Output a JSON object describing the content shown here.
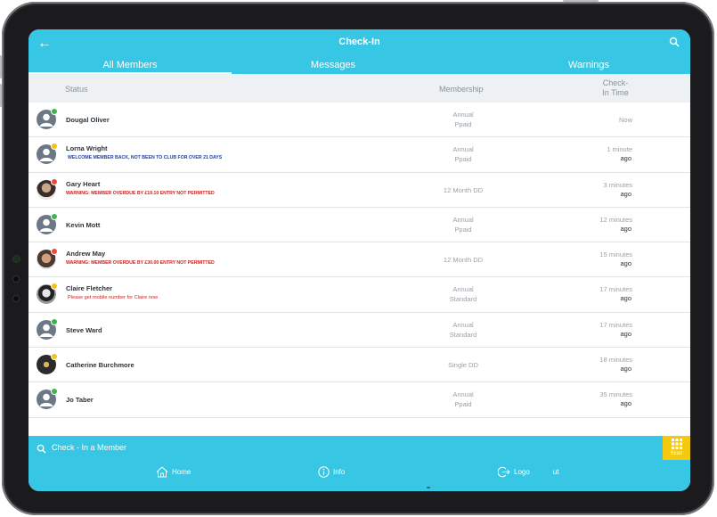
{
  "header": {
    "title": "Check-In",
    "back_icon": "arrow-left-icon",
    "search_icon": "search-icon"
  },
  "tabs": [
    {
      "label": "All Members",
      "active": true
    },
    {
      "label": "Messages",
      "active": false
    },
    {
      "label": "Warnings",
      "active": false
    }
  ],
  "columns": {
    "status": "Status",
    "membership": "Membership",
    "checkin_line1": "Check-",
    "checkin_line2": "In Time"
  },
  "colors": {
    "accent": "#37c6e3",
    "scan": "#f5c90f",
    "online": "#3fb34f",
    "pending": "#f2c316",
    "alert": "#e84a3c",
    "warning_text": "#cc2222",
    "info_text": "#1f3fa8"
  },
  "members": [
    {
      "name": "Dougal Oliver",
      "note": "",
      "note_type": "",
      "membership_1": "Annual",
      "membership_2": "Ppaid",
      "time_1": "Now",
      "time_2": "",
      "status": "online",
      "avatar": "default"
    },
    {
      "name": "Lorna Wright",
      "note": "WELCOME MEMBER BACK, NOT BEEN TO CLUB FOR OVER 21 DAYS",
      "note_type": "info",
      "membership_1": "Annual",
      "membership_2": "Ppaid",
      "time_1": "1 minute",
      "time_2": "ago",
      "status": "pending",
      "avatar": "default"
    },
    {
      "name": "Gary Heart",
      "note": "WARNING: MEMBER OVERDUE BY £19.10 ENTRY NOT PERMITTED",
      "note_type": "warning",
      "membership_1": "12 Month DD",
      "membership_2": "",
      "time_1": "3 minutes",
      "time_2": "ago",
      "status": "alert",
      "avatar": "photo"
    },
    {
      "name": "Kevin Mott",
      "note": "",
      "note_type": "",
      "membership_1": "Annual",
      "membership_2": "Ppaid",
      "time_1": "12 minutes",
      "time_2": "ago",
      "status": "online",
      "avatar": "default"
    },
    {
      "name": "Andrew May",
      "note": "WARNING: MEMBER OVERDUE BY £30.00 ENTRY NOT PERMITTED",
      "note_type": "warning",
      "membership_1": "12 Month DD",
      "membership_2": "",
      "time_1": "15 minutes",
      "time_2": "ago",
      "status": "alert",
      "avatar": "photo"
    },
    {
      "name": "Claire Fletcher",
      "note": "Please get mobile number for Claire now",
      "note_type": "warning-lower",
      "membership_1": "Annual",
      "membership_2": "Standard",
      "time_1": "17 minutes",
      "time_2": "ago",
      "status": "pending",
      "avatar": "photo"
    },
    {
      "name": "Steve Ward",
      "note": "",
      "note_type": "",
      "membership_1": "Annual",
      "membership_2": "Standard",
      "time_1": "17 minutes",
      "time_2": "ago",
      "status": "online",
      "avatar": "default"
    },
    {
      "name": "Catherine Burchmore",
      "note": "",
      "note_type": "",
      "membership_1": "Single DD",
      "membership_2": "",
      "time_1": "18 minutes",
      "time_2": "ago",
      "status": "pending",
      "avatar": "photo"
    },
    {
      "name": "Jo Taber",
      "note": "",
      "note_type": "",
      "membership_1": "Annual",
      "membership_2": "Ppaid",
      "time_1": "35 minutes",
      "time_2": "ago",
      "status": "online",
      "avatar": "default"
    }
  ],
  "search": {
    "placeholder": "Check - In a Member",
    "icon": "search-icon"
  },
  "scan": {
    "label": "Scan",
    "icon": "qr-grid-icon"
  },
  "bottom_nav": [
    {
      "label": "Home",
      "icon": "home-icon"
    },
    {
      "label": "Info",
      "icon": "info-icon"
    },
    {
      "label": "Logo",
      "label_tail": "ut",
      "icon": "logout-icon"
    }
  ]
}
